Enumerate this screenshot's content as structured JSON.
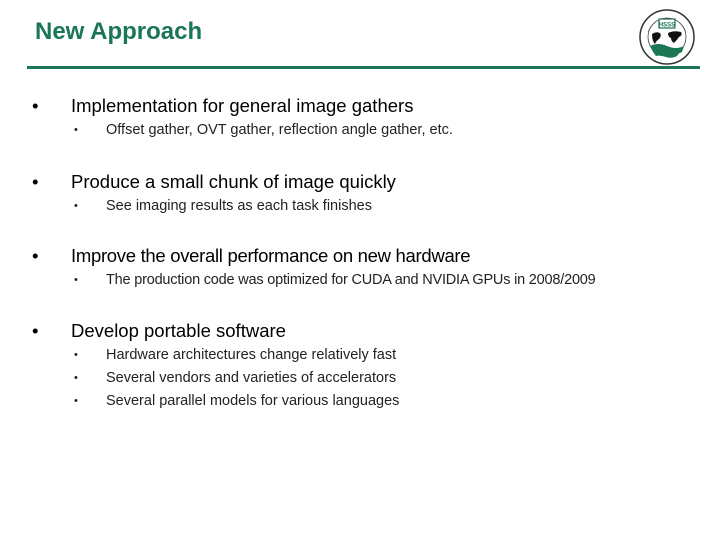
{
  "slide": {
    "title": "New Approach",
    "accent_color": "#1b7654",
    "logo": {
      "icon": "globe-seal-logo-icon",
      "badge_text": "HSSS"
    },
    "bullets": [
      {
        "text": "Implementation for general image gathers",
        "sub": [
          "Offset gather, OVT gather, reflection angle gather, etc."
        ]
      },
      {
        "text": "Produce a small chunk of image quickly",
        "sub": [
          "See imaging results as each task finishes"
        ]
      },
      {
        "text": "Improve the overall performance on new hardware",
        "sub": [
          "The production code was optimized for CUDA and NVIDIA GPUs in 2008/2009"
        ]
      },
      {
        "text": "Develop portable software",
        "sub": [
          "Hardware architectures change relatively fast",
          "Several vendors and varieties of accelerators",
          "Several parallel models for various languages"
        ]
      }
    ],
    "bullet_glyph": "•"
  }
}
